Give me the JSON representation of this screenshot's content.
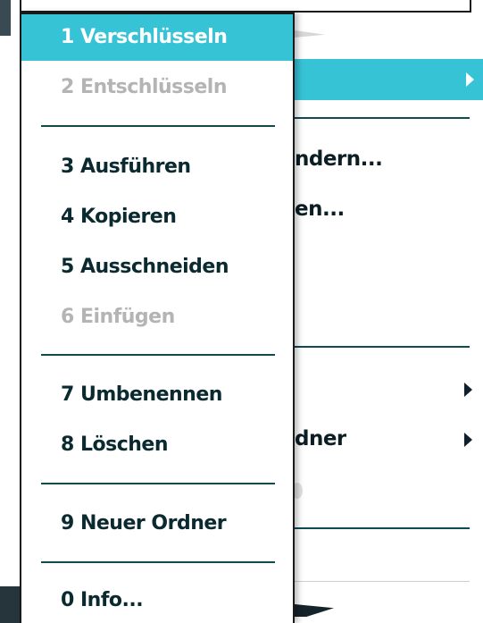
{
  "popup_menu": {
    "items": [
      {
        "label": "1 Verschlüsseln",
        "state": "selected"
      },
      {
        "label": "2 Entschlüsseln",
        "state": "disabled"
      },
      {
        "label": "3 Ausführen",
        "state": "enabled"
      },
      {
        "label": "4 Kopieren",
        "state": "enabled"
      },
      {
        "label": "5 Ausschneiden",
        "state": "enabled"
      },
      {
        "label": "6 Einfügen",
        "state": "disabled"
      },
      {
        "label": "7 Umbenennen",
        "state": "enabled"
      },
      {
        "label": "8 Löschen",
        "state": "enabled"
      },
      {
        "label": "9 Neuer Ordner",
        "state": "enabled"
      },
      {
        "label": "0 Info...",
        "state": "enabled"
      }
    ]
  },
  "background_menu": {
    "visible_fragments": [
      "ndern...",
      "en...",
      "dner"
    ]
  },
  "colors": {
    "highlight": "#37c3d6",
    "text": "#0a2a30",
    "disabled_text": "#b4b4b4",
    "separator": "#0e4d4f"
  },
  "icons": [
    "submenu-arrow-icon"
  ]
}
